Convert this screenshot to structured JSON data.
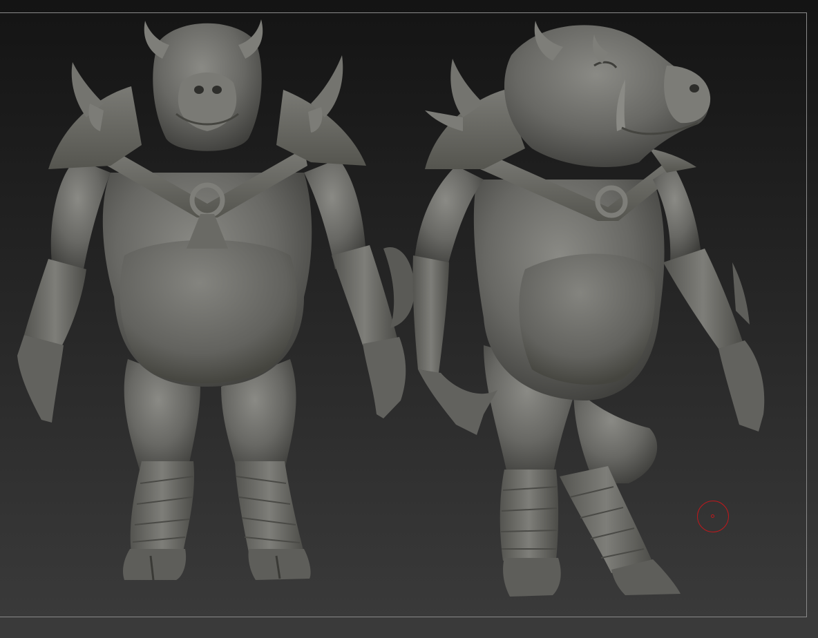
{
  "viewport": {
    "background_top": "#141414",
    "background_bottom": "#3a3a3a",
    "frame_color": "#8a8a8a"
  },
  "models": [
    {
      "name": "front-view",
      "view": "front",
      "material_color": "#6a6a66"
    },
    {
      "name": "three-quarter-view",
      "view": "three-quarter",
      "material_color": "#6a6a66"
    }
  ],
  "cursor": {
    "type": "brush-circle",
    "color": "#c0181c"
  }
}
